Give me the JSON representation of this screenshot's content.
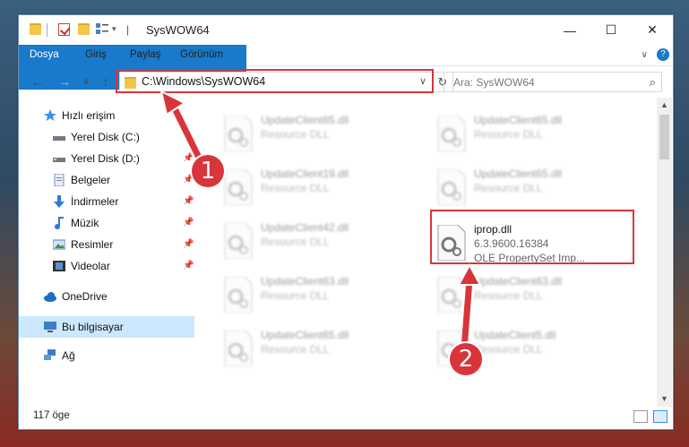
{
  "window": {
    "title": "SysWOW64",
    "minimize": "—",
    "maximize": "☐",
    "close": "✕"
  },
  "ribbon": {
    "tabs": [
      "Dosya",
      "Giriş",
      "Paylaş",
      "Görünüm"
    ],
    "help": "?",
    "collapse": "∨"
  },
  "navbar": {
    "back": "←",
    "forward": "→",
    "recent": "∨",
    "up": "↑",
    "address": "C:\\Windows\\SysWOW64",
    "dropdown": "∨",
    "refresh": "↻",
    "search_placeholder": "Ara: SysWOW64",
    "search_icon": "⌕"
  },
  "sidebar": {
    "quick_access": "Hızlı erişim",
    "items": [
      {
        "label": "Yerel Disk (C:)",
        "icon": "drive-icon"
      },
      {
        "label": "Yerel Disk (D:)",
        "icon": "drive-icon"
      },
      {
        "label": "Belgeler",
        "icon": "documents-icon"
      },
      {
        "label": "İndirmeler",
        "icon": "downloads-icon"
      },
      {
        "label": "Müzik",
        "icon": "music-icon"
      },
      {
        "label": "Resimler",
        "icon": "pictures-icon"
      },
      {
        "label": "Videolar",
        "icon": "videos-icon"
      }
    ],
    "onedrive": "OneDrive",
    "this_pc": "Bu bilgisayar",
    "network": "Ağ",
    "pin": "📌"
  },
  "files": {
    "col1": [
      {
        "name": "UpdateClient65.dll",
        "type": "Resource DLL"
      },
      {
        "name": "UpdateClient19.dll",
        "type": "Resource DLL"
      },
      {
        "name": "UpdateClient42.dll",
        "type": "Resource DLL"
      },
      {
        "name": "UpdateClient63.dll",
        "type": "Resource DLL"
      },
      {
        "name": "UpdateClient65.dll",
        "type": "Resource DLL"
      }
    ],
    "col2": [
      {
        "name": "UpdateClient65.dll",
        "type": "Resource DLL"
      },
      {
        "name": "UpdateClient65.dll",
        "type": "Resource DLL"
      },
      {
        "name": "UpdateClient63.dll",
        "type": "Resource DLL"
      },
      {
        "name": "UpdateClient5.dll",
        "type": "Resource DLL"
      }
    ],
    "highlight": {
      "name": "iprop.dll",
      "version": "6.3.9600.16384",
      "description": "OLE PropertySet Imp..."
    }
  },
  "status": {
    "count": "117 öge"
  },
  "annotations": {
    "step1": "1",
    "step2": "2"
  },
  "colors": {
    "accent": "#1979ca",
    "highlight_border": "#d8353b",
    "selected": "#cce8ff"
  }
}
